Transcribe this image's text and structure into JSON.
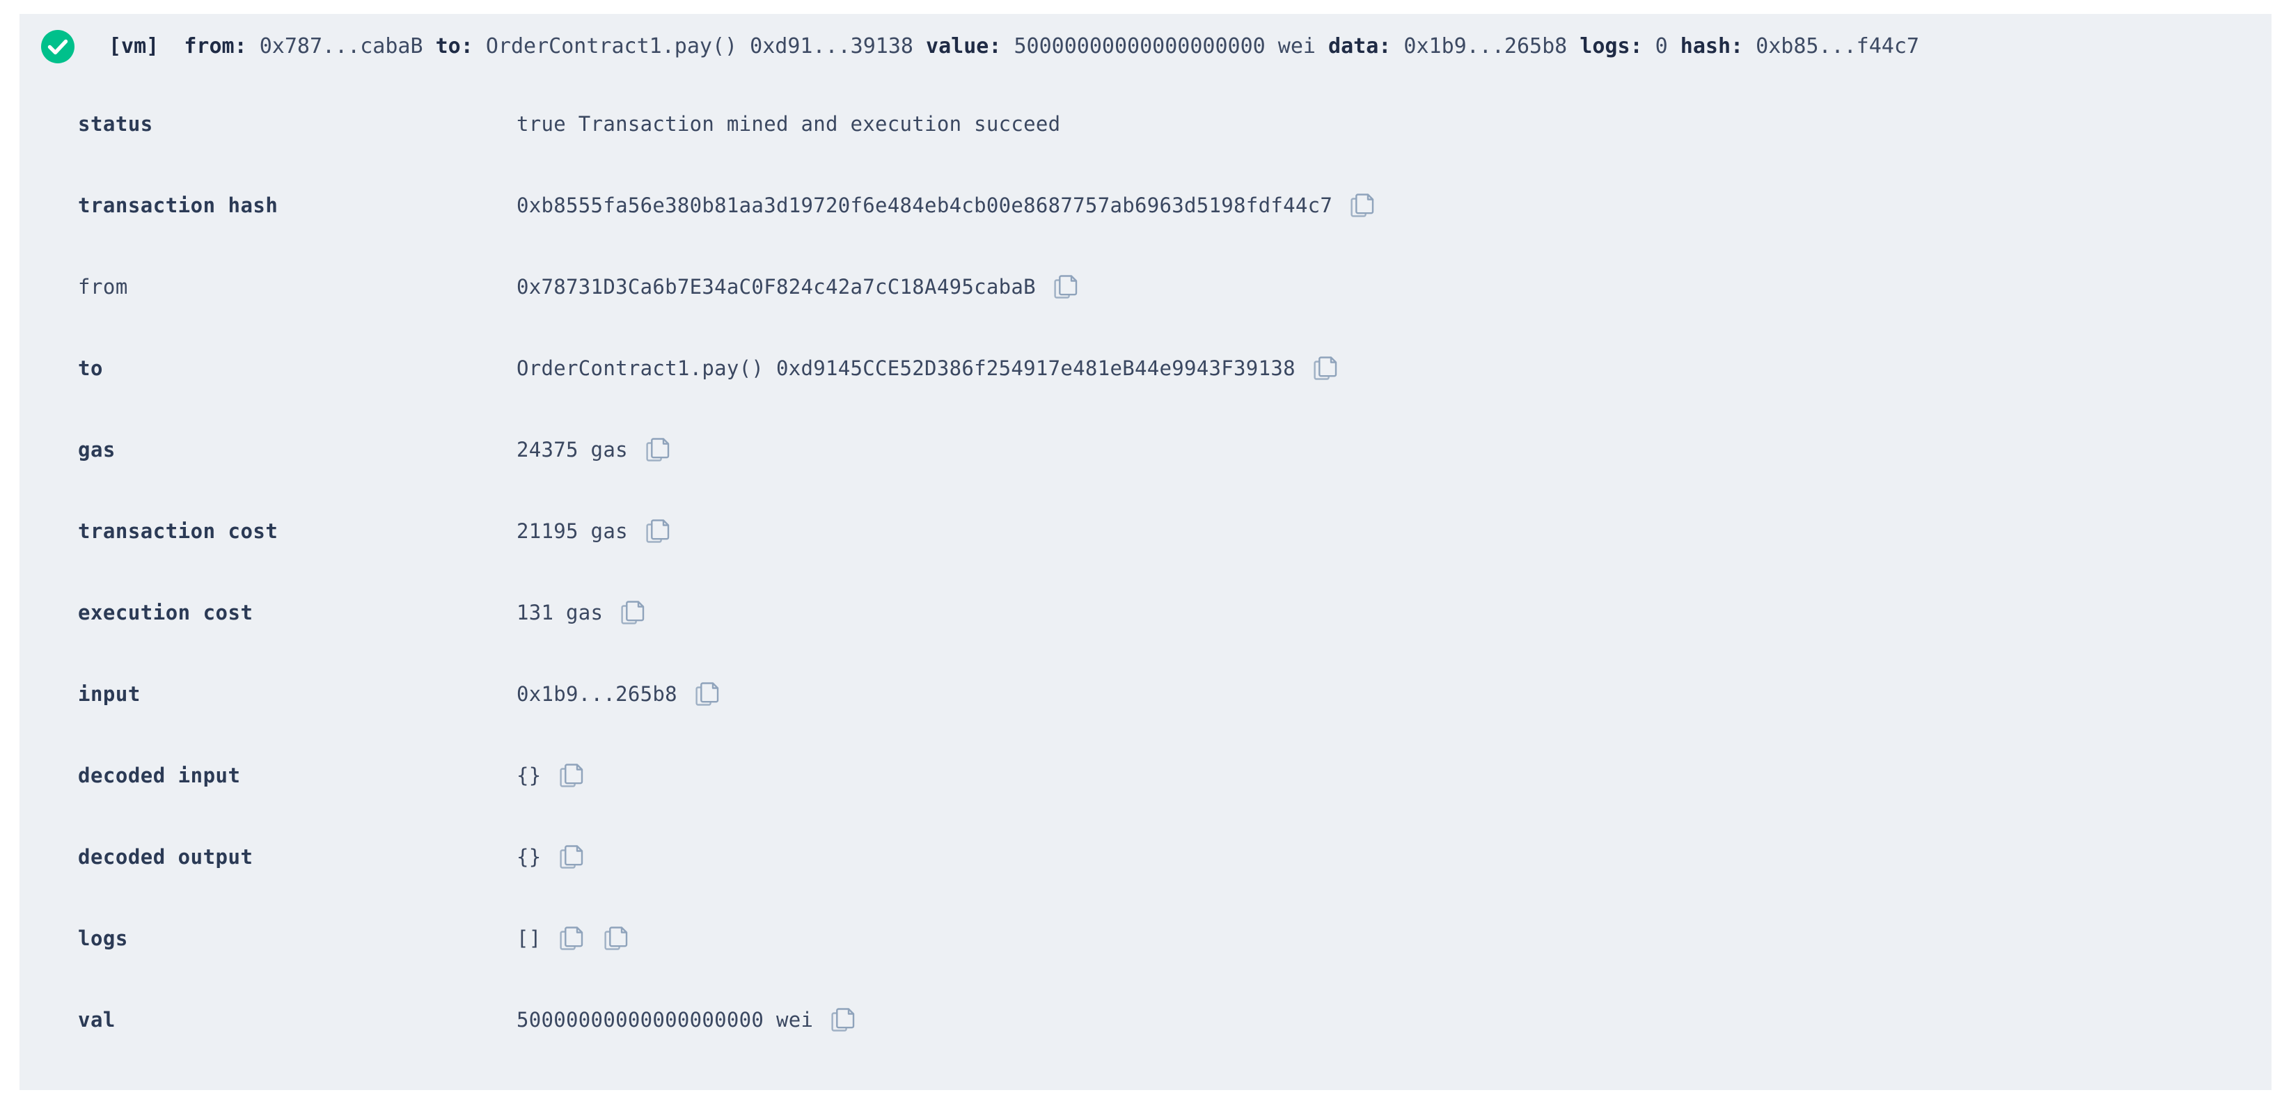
{
  "panel": {
    "background_color": "#edf0f4",
    "status_icon": "check-circle-icon",
    "status_icon_color": "#00c08b"
  },
  "header": {
    "vm_tag": "[vm]",
    "items": [
      {
        "key": "from:",
        "value": "0x787...cabaB"
      },
      {
        "key": "to:",
        "value": "OrderContract1.pay() 0xd91...39138"
      },
      {
        "key": "value:",
        "value": "50000000000000000000 wei"
      },
      {
        "key": "data:",
        "value": "0x1b9...265b8"
      },
      {
        "key": "logs:",
        "value": "0"
      },
      {
        "key": "hash:",
        "value": "0xb85...f44c7"
      }
    ]
  },
  "rows": [
    {
      "label": "status",
      "label_bold": true,
      "value": "true Transaction mined and execution succeed",
      "copy_buttons": 0
    },
    {
      "label": "transaction hash",
      "label_bold": true,
      "value": "0xb8555fa56e380b81aa3d19720f6e484eb4cb00e8687757ab6963d5198fdf44c7",
      "copy_buttons": 1
    },
    {
      "label": "from",
      "label_bold": false,
      "value": "0x78731D3Ca6b7E34aC0F824c42a7cC18A495cabaB",
      "copy_buttons": 1
    },
    {
      "label": "to",
      "label_bold": true,
      "value": "OrderContract1.pay() 0xd9145CCE52D386f254917e481eB44e9943F39138",
      "copy_buttons": 1
    },
    {
      "label": "gas",
      "label_bold": true,
      "value": "24375 gas",
      "copy_buttons": 1
    },
    {
      "label": "transaction cost",
      "label_bold": true,
      "value": "21195 gas",
      "copy_buttons": 1
    },
    {
      "label": "execution cost",
      "label_bold": true,
      "value": "131 gas",
      "copy_buttons": 1
    },
    {
      "label": "input",
      "label_bold": true,
      "value": "0x1b9...265b8",
      "copy_buttons": 1
    },
    {
      "label": "decoded input",
      "label_bold": true,
      "value": "{}",
      "copy_buttons": 1
    },
    {
      "label": "decoded output",
      "label_bold": true,
      "value": "{}",
      "copy_buttons": 1
    },
    {
      "label": "logs",
      "label_bold": true,
      "value": "[]",
      "copy_buttons": 2
    },
    {
      "label": "val",
      "label_bold": true,
      "value": "50000000000000000000 wei",
      "copy_buttons": 1
    }
  ],
  "icons": {
    "copy": "copy-icon",
    "status": "check-circle-icon"
  }
}
